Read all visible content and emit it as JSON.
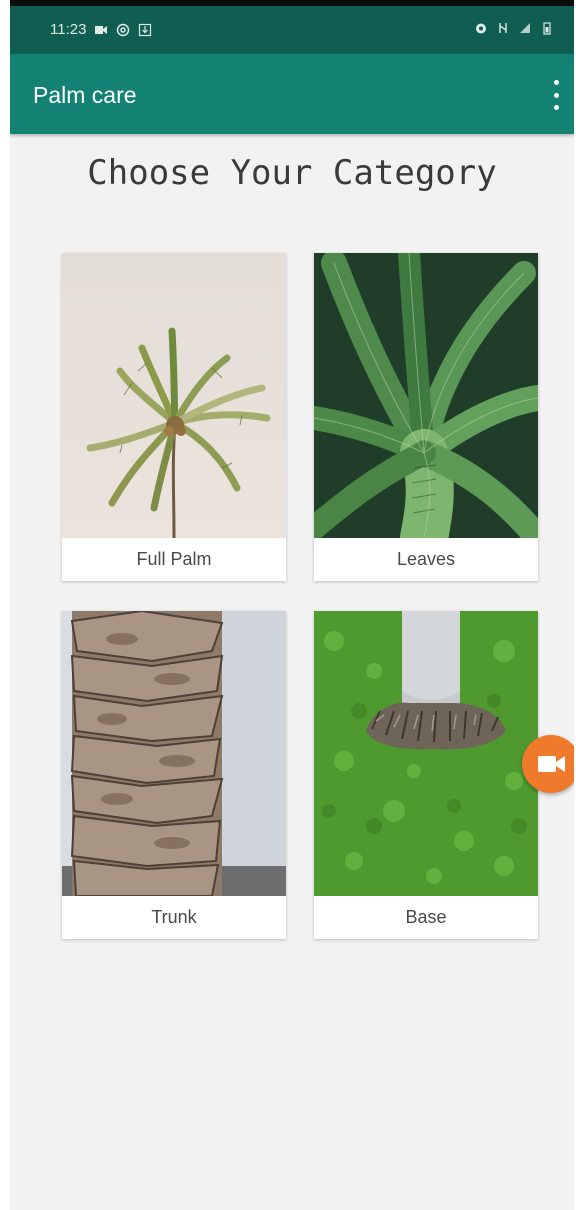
{
  "status_bar": {
    "time": "11:23",
    "left_icons": [
      "video-icon",
      "at-sign-icon",
      "download-icon"
    ],
    "right_icons": [
      "alarm-icon",
      "sync-icon",
      "signal-icon",
      "battery-icon"
    ]
  },
  "app_bar": {
    "title": "Palm care",
    "menu_icon": "more-vertical-icon"
  },
  "heading": "Choose Your Category",
  "categories": [
    {
      "label": "Full Palm",
      "image": "full-palm-photo"
    },
    {
      "label": "Leaves",
      "image": "leaves-photo"
    },
    {
      "label": "Trunk",
      "image": "trunk-photo"
    },
    {
      "label": "Base",
      "image": "base-photo"
    }
  ],
  "floating_button": {
    "icon": "video-camera-icon"
  },
  "colors": {
    "status_bar": "#0f5e51",
    "app_bar": "#148272",
    "background": "#f2f2f2",
    "fab": "#f07a2b"
  }
}
